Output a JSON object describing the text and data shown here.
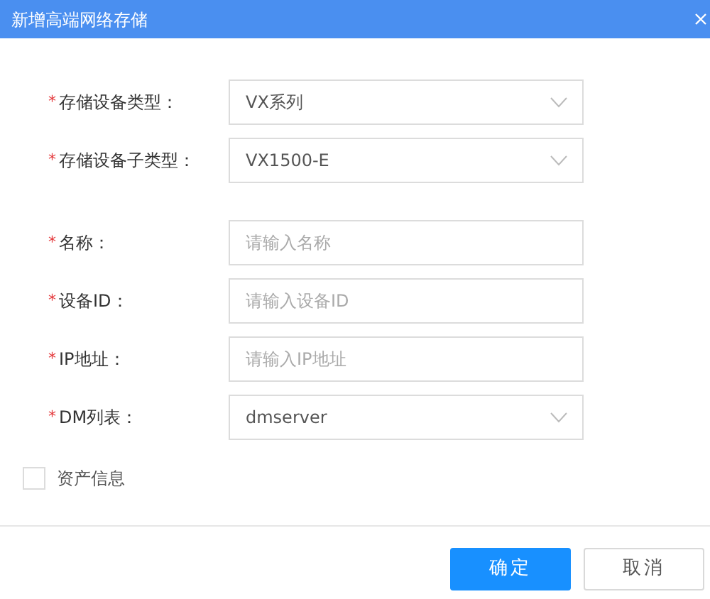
{
  "window": {
    "title": "新增高端网络存储"
  },
  "fields": [
    {
      "kind": "select",
      "required_mark": "*",
      "label": "存储设备类型：",
      "value": "VX系列"
    },
    {
      "kind": "select",
      "required_mark": "*",
      "label": "存储设备子类型：",
      "value": "VX1500-E"
    },
    {
      "kind": "spacer"
    },
    {
      "kind": "input",
      "required_mark": "*",
      "label": "名称：",
      "placeholder": "请输入名称"
    },
    {
      "kind": "input",
      "required_mark": "*",
      "label": "设备ID：",
      "placeholder": "请输入设备ID"
    },
    {
      "kind": "input",
      "required_mark": "*",
      "label": "IP地址：",
      "placeholder": "请输入IP地址"
    },
    {
      "kind": "select",
      "required_mark": "*",
      "label": "DM列表：",
      "value": "dmserver"
    }
  ],
  "asset_info": {
    "label": "资产信息",
    "checked": false
  },
  "buttons": [
    {
      "kind": "primary",
      "label": "确定"
    },
    {
      "kind": "default",
      "label": "取消"
    }
  ]
}
